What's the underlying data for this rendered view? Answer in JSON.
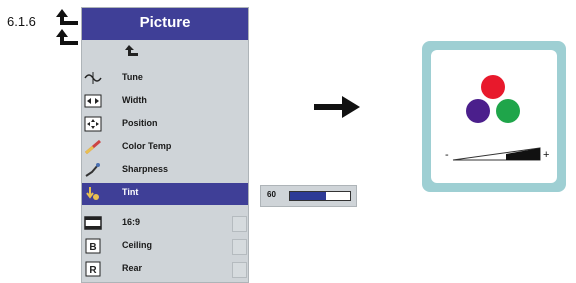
{
  "step_number": "6.1.6",
  "menu": {
    "title": "Picture",
    "items": [
      {
        "label": "Tune",
        "icon": "tune-icon"
      },
      {
        "label": "Width",
        "icon": "width-icon"
      },
      {
        "label": "Position",
        "icon": "position-icon"
      },
      {
        "label": "Color Temp",
        "icon": "color-temp-icon"
      },
      {
        "label": "Sharpness",
        "icon": "sharpness-icon"
      },
      {
        "label": "Tint",
        "icon": "tint-icon",
        "selected": true
      },
      {
        "label": "16:9",
        "icon": "aspect-ratio-icon"
      },
      {
        "label": "Ceiling",
        "icon": "ceiling-icon"
      },
      {
        "label": "Rear",
        "icon": "rear-icon"
      }
    ]
  },
  "tint_slider": {
    "value": "60",
    "fill_fraction": 0.6
  },
  "tint_card": {
    "minus": "-",
    "plus": "+",
    "colors": {
      "red": "#e8192c",
      "purple": "#4b1f8c",
      "green": "#1fa54a"
    }
  },
  "colors": {
    "menu_bg": "#cfd4d8",
    "accent": "#3f3f97",
    "card_border": "#9ecfd3"
  }
}
